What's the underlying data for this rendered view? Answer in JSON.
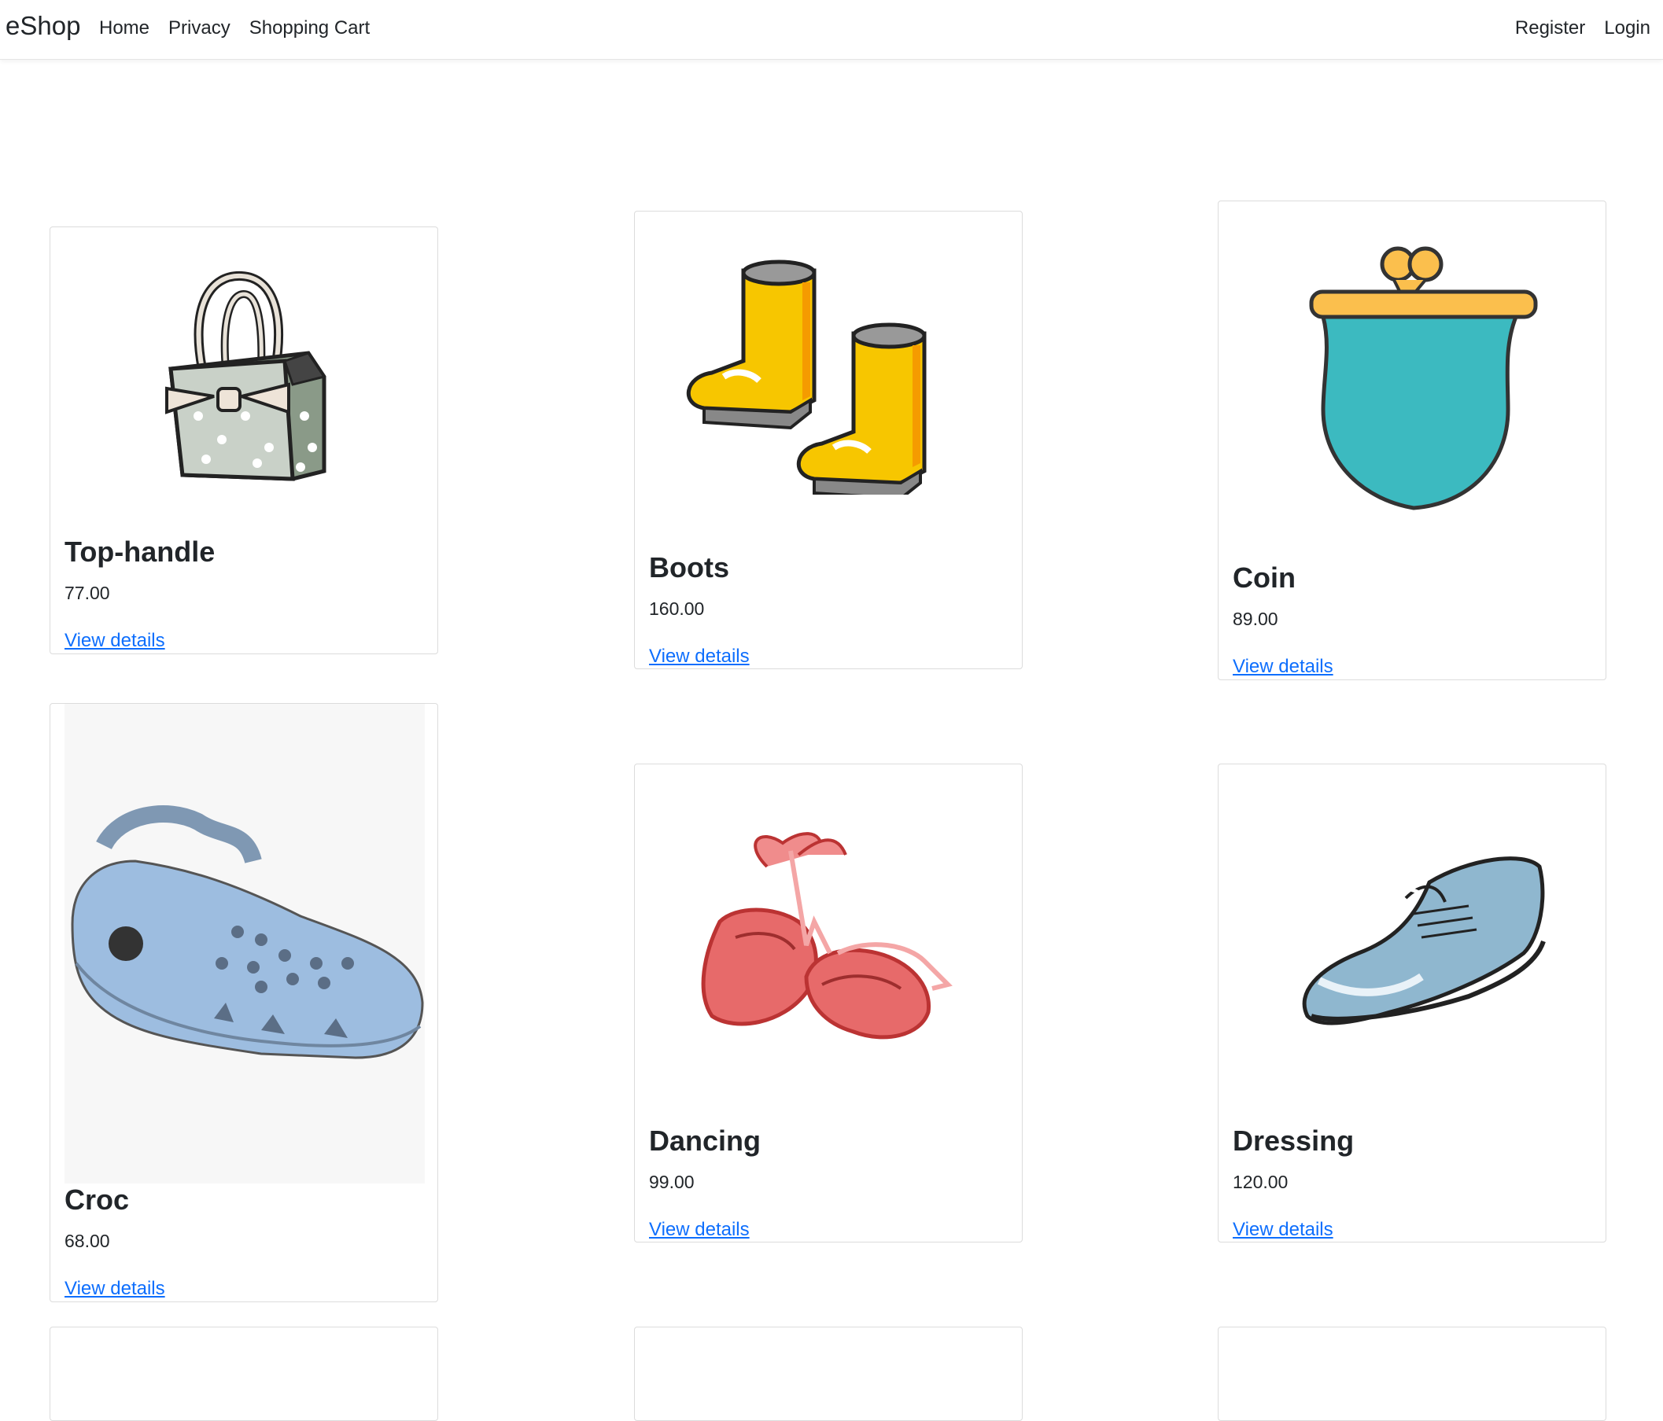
{
  "nav": {
    "brand": "eShop",
    "left": [
      "Home",
      "Privacy",
      "Shopping Cart"
    ],
    "right": [
      "Register",
      "Login"
    ]
  },
  "products": [
    {
      "name": "Top-handle",
      "price": "77.00",
      "link": "View details",
      "icon": "top-handle-bag-icon"
    },
    {
      "name": "Boots",
      "price": "160.00",
      "link": "View details",
      "icon": "rain-boots-icon"
    },
    {
      "name": "Coin",
      "price": "89.00",
      "link": "View details",
      "icon": "coin-purse-icon"
    },
    {
      "name": "Croc",
      "price": "68.00",
      "link": "View details",
      "icon": "croc-shoe-icon"
    },
    {
      "name": "Dancing",
      "price": "99.00",
      "link": "View details",
      "icon": "ballet-shoes-icon"
    },
    {
      "name": "Dressing",
      "price": "120.00",
      "link": "View details",
      "icon": "dress-shoe-icon"
    }
  ],
  "colors": {
    "link": "#0d6efd",
    "text": "#212529",
    "border": "#dcdcdc"
  }
}
